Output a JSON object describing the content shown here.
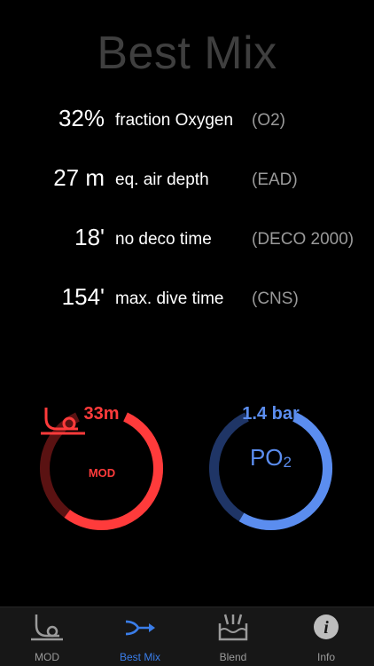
{
  "title": "Best Mix",
  "rows": [
    {
      "value": "32%",
      "desc": "fraction Oxygen",
      "abbr": "(O2)"
    },
    {
      "value": "27 m",
      "desc": "eq. air depth",
      "abbr": "(EAD)"
    },
    {
      "value": "18'",
      "desc": "no deco time",
      "abbr": "(DECO 2000)"
    },
    {
      "value": "154'",
      "desc": "max. dive time",
      "abbr": "(CNS)"
    }
  ],
  "gauges": {
    "mod": {
      "value": "33m",
      "label": "MOD",
      "icon": "mod-dive-icon",
      "color": "#ff3b3b",
      "dim_color": "#5a1212",
      "fill_fraction": 0.62
    },
    "po2": {
      "value": "1.4 bar",
      "label": "PO",
      "label_sub": "2",
      "color": "#5b8def",
      "dim_color": "#1f3566",
      "fill_fraction": 0.6
    }
  },
  "tabs": [
    {
      "label": "MOD",
      "icon": "mod-icon",
      "active": false
    },
    {
      "label": "Best Mix",
      "icon": "best-mix-icon",
      "active": true
    },
    {
      "label": "Blend",
      "icon": "blend-icon",
      "active": false
    },
    {
      "label": "Info",
      "icon": "info-icon",
      "active": false
    }
  ]
}
